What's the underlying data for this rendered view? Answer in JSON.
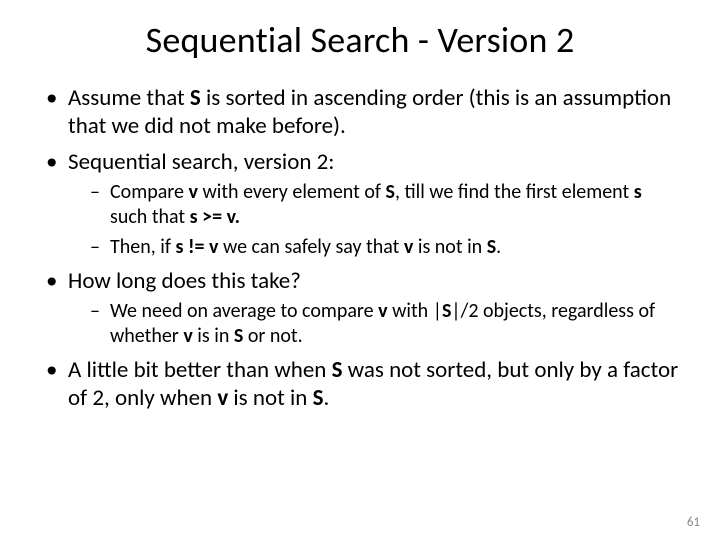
{
  "title": "Sequential Search - Version 2",
  "bullets": {
    "b1a": "Assume that ",
    "b1b": "S",
    "b1c": " is sorted in ascending order (this is an assumption that we did not make before).",
    "b2": "Sequential search, version 2:",
    "s1a": "Compare ",
    "s1b": "v",
    "s1c": " with every element of ",
    "s1d": "S",
    "s1e": ", till we find the first element ",
    "s1f": "s",
    "s1g": " such that ",
    "s1h": "s >= v.",
    "s2a": "Then, if ",
    "s2b": "s != v",
    "s2c": " we can safely say that ",
    "s2d": "v",
    "s2e": " is not in ",
    "s2f": "S",
    "s2g": ".",
    "b3": "How long does this take?",
    "s3a": "We need on average to compare ",
    "s3b": "v",
    "s3c": " with |",
    "s3d": "S",
    "s3e": "|/2 objects, regardless of whether ",
    "s3f": "v",
    "s3g": " is in ",
    "s3h": "S",
    "s3i": " or not.",
    "b4a": "A little bit better than when ",
    "b4b": "S",
    "b4c": " was not sorted, but only by a factor of 2, only when ",
    "b4d": "v",
    "b4e": " is not in ",
    "b4f": "S",
    "b4g": "."
  },
  "page": "61"
}
